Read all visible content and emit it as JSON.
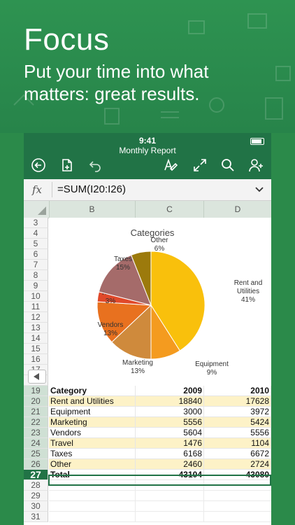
{
  "hero": {
    "title": "Focus",
    "subtitle": "Put your time into what matters: great results."
  },
  "status": {
    "time": "9:41"
  },
  "toolbar": {
    "doc_title": "Monthly Report",
    "icons": [
      "back-arrow-icon",
      "file-icon",
      "undo-icon",
      "format-icon",
      "expand-icon",
      "search-icon",
      "add-user-icon"
    ]
  },
  "formula_bar": {
    "fx_label": "fx",
    "value": "=SUM(I20:I26)"
  },
  "columns": [
    "B",
    "C",
    "D"
  ],
  "rows": [
    "3",
    "4",
    "5",
    "6",
    "7",
    "8",
    "9",
    "10",
    "11",
    "12",
    "13",
    "14",
    "15",
    "16",
    "17",
    "18",
    "19",
    "20",
    "21",
    "22",
    "23",
    "24",
    "25",
    "26",
    "27",
    "28",
    "29",
    "30",
    "31"
  ],
  "active_row": "27",
  "table": {
    "header": [
      "Category",
      "2009",
      "2010"
    ],
    "rows": [
      [
        "Rent and Utilities",
        "18840",
        "17628"
      ],
      [
        "Equipment",
        "3000",
        "3972"
      ],
      [
        "Marketing",
        "5556",
        "5424"
      ],
      [
        "Vendors",
        "5604",
        "5556"
      ],
      [
        "Travel",
        "1476",
        "1104"
      ],
      [
        "Taxes",
        "6168",
        "6672"
      ],
      [
        "Other",
        "2460",
        "2724"
      ]
    ],
    "total": [
      "Total",
      "43104",
      "43080"
    ]
  },
  "chart_data": {
    "type": "pie",
    "title": "Categories",
    "slices": [
      {
        "label": "Rent and Utilities",
        "pct_label": "41%",
        "value": 41,
        "color": "#f9c00c"
      },
      {
        "label": "Equipment",
        "pct_label": "9%",
        "value": 9,
        "color": "#f49b1f"
      },
      {
        "label": "Marketing",
        "pct_label": "13%",
        "value": 13,
        "color": "#cf8a3c"
      },
      {
        "label": "Vendors",
        "pct_label": "13%",
        "value": 13,
        "color": "#e8711f"
      },
      {
        "label": "Travel",
        "pct_label": "3%",
        "value": 3,
        "color": "#e0492a"
      },
      {
        "label": "Taxes",
        "pct_label": "15%",
        "value": 15,
        "color": "#a56b6a"
      },
      {
        "label": "Other",
        "pct_label": "6%",
        "value": 6,
        "color": "#9c7a0c"
      }
    ]
  },
  "colors": {
    "brand": "#217346",
    "hero": "#2b8a4a",
    "band": "#fdf2c7"
  }
}
